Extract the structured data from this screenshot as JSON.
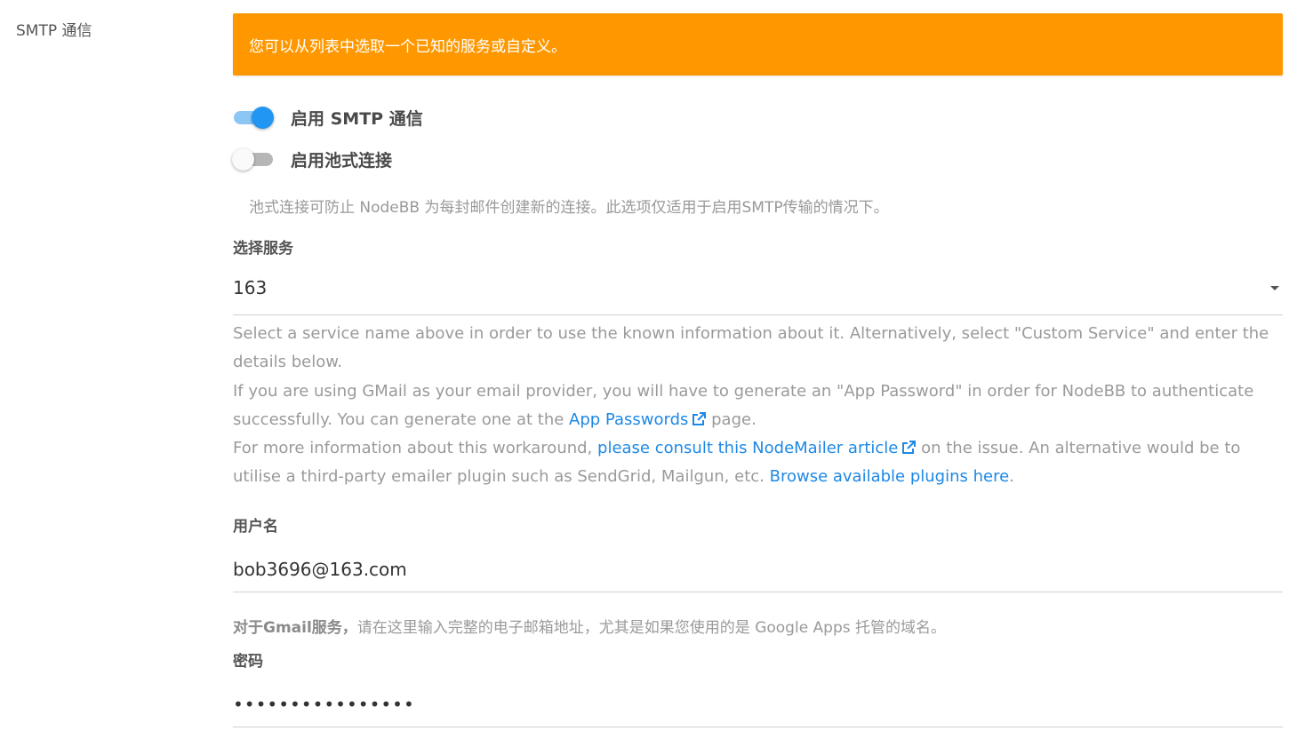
{
  "section": {
    "label": "SMTP 通信"
  },
  "alert": {
    "text": "您可以从列表中选取一个已知的服务或自定义。"
  },
  "toggles": {
    "smtp": {
      "label": "启用 SMTP 通信",
      "checked": true
    },
    "pool": {
      "label": "启用池式连接",
      "checked": false
    }
  },
  "pool_help": "池式连接可防止 NodeBB 为每封邮件创建新的连接。此选项仅适用于启用SMTP传输的情况下。",
  "service": {
    "label": "选择服务",
    "value": "163",
    "help": {
      "line1": "Select a service name above in order to use the known information about it. Alternatively, select \"Custom Service\" and enter the details below.",
      "line2_pre": "If you are using GMail as your email provider, you will have to generate an \"App Password\" in order for NodeBB to authenticate successfully. You can generate one at the ",
      "line2_link": "App Passwords",
      "line2_post": " page.",
      "line3_pre": "For more information about this workaround, ",
      "line3_link": "please consult this NodeMailer article",
      "line3_mid": " on the issue. An alternative would be to utilise a third-party emailer plugin such as SendGrid, Mailgun, etc. ",
      "line3_link2": "Browse available plugins here",
      "line3_post": "."
    }
  },
  "username": {
    "label": "用户名",
    "value": "bob3696@163.com",
    "help_bold": "对于Gmail服务，",
    "help_rest": "请在这里输入完整的电子邮箱地址，尤其是如果您使用的是 Google Apps 托管的域名。"
  },
  "password": {
    "label": "密码",
    "value": "••••••••••••••••"
  },
  "colors": {
    "alert": "#ff9800",
    "accent": "#2196f3",
    "link": "#1e88e5"
  }
}
